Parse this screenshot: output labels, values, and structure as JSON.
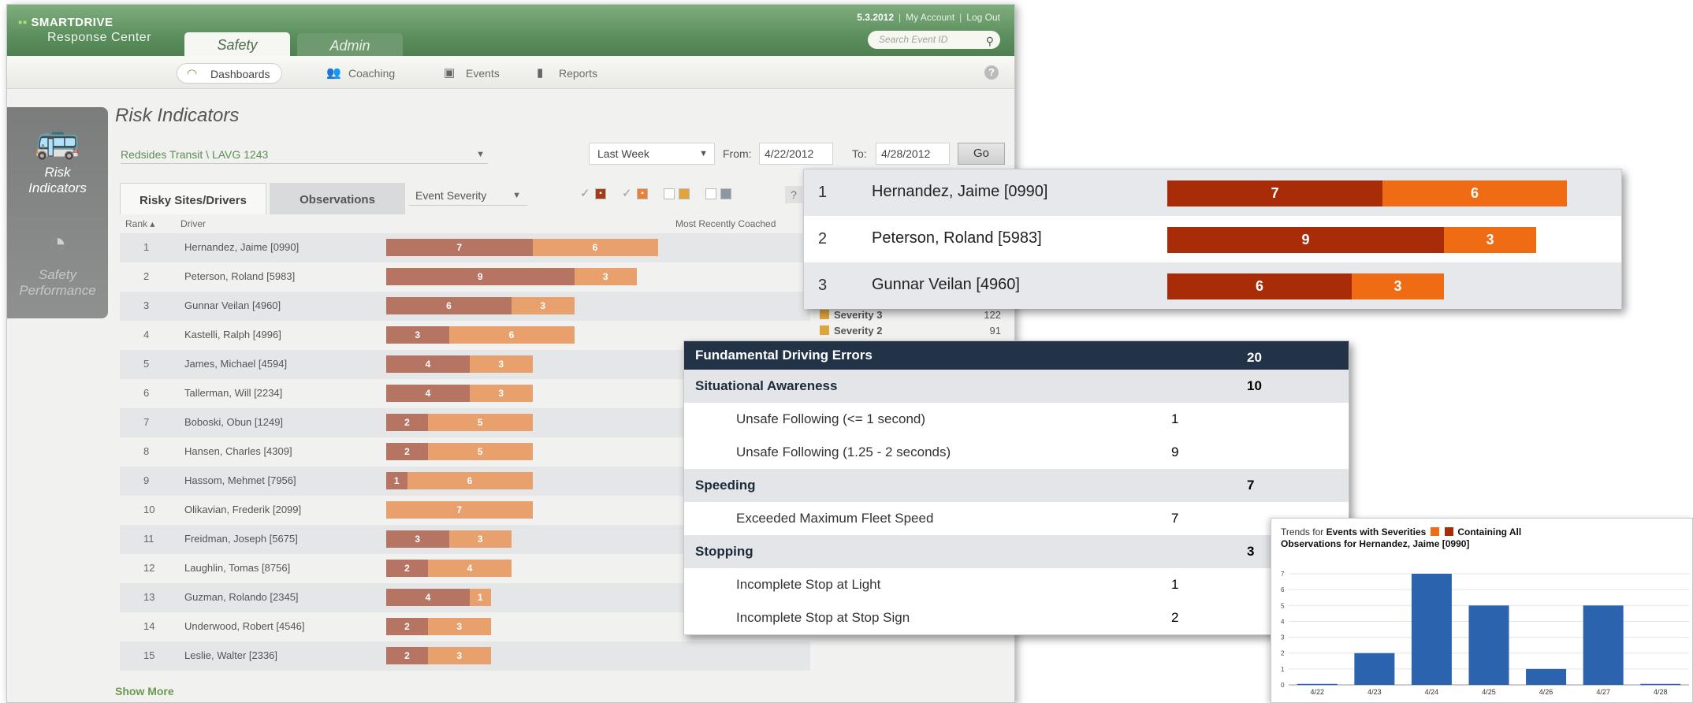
{
  "app": {
    "logo_line1": "SMARTDRIVE",
    "logo_line2": "Response Center",
    "tabs": [
      "Safety",
      "Admin"
    ],
    "date": "5.3.2012",
    "my_account": "My Account",
    "logout": "Log Out",
    "search_placeholder": "Search Event ID"
  },
  "nav": {
    "dashboards": "Dashboards",
    "coaching": "Coaching",
    "events": "Events",
    "reports": "Reports"
  },
  "sidebar": {
    "risk": [
      "Risk",
      "Indicators"
    ],
    "perf": [
      "Safety",
      "Performance"
    ]
  },
  "page": {
    "title": "Risk Indicators",
    "site": "Redsides Transit \\ LAVG 1243",
    "period": "Last Week",
    "from_label": "From:",
    "from_value": "4/22/2012",
    "to_label": "To:",
    "to_value": "4/28/2012",
    "go": "Go",
    "tab_risky": "Risky Sites/Drivers",
    "tab_obs": "Observations",
    "sev_select": "Event Severity",
    "help": "?",
    "col_rank": "Rank",
    "col_driver": "Driver",
    "col_coached": "Most Recently Coached",
    "show_more": "Show More"
  },
  "colors": {
    "main_dark": "#b67563",
    "main_light": "#e8a16c",
    "zoom_dark": "#a72c07",
    "zoom_light": "#ef6c14",
    "chart_bar": "#2c63ae"
  },
  "drivers": [
    {
      "rank": "1",
      "name": "Hernandez, Jaime [0990]",
      "dark": 7,
      "light": 6
    },
    {
      "rank": "2",
      "name": "Peterson, Roland [5983]",
      "dark": 9,
      "light": 3
    },
    {
      "rank": "3",
      "name": "Gunnar Veilan [4960]",
      "dark": 6,
      "light": 3
    },
    {
      "rank": "4",
      "name": "Kastelli, Ralph [4996]",
      "dark": 3,
      "light": 6
    },
    {
      "rank": "5",
      "name": "James, Michael [4594]",
      "dark": 4,
      "light": 3
    },
    {
      "rank": "6",
      "name": "Tallerman, Will [2234]",
      "dark": 4,
      "light": 3
    },
    {
      "rank": "7",
      "name": "Boboski, Obun [1249]",
      "dark": 2,
      "light": 5
    },
    {
      "rank": "8",
      "name": "Hansen, Charles [4309]",
      "dark": 2,
      "light": 5
    },
    {
      "rank": "9",
      "name": "Hassom, Mehmet [7956]",
      "dark": 1,
      "light": 6
    },
    {
      "rank": "10",
      "name": "Olikavian, Frederik [2099]",
      "dark": 0,
      "light": 7
    },
    {
      "rank": "11",
      "name": "Freidman, Joseph [5675]",
      "dark": 3,
      "light": 3
    },
    {
      "rank": "12",
      "name": "Laughlin, Tomas [8756]",
      "dark": 2,
      "light": 4
    },
    {
      "rank": "13",
      "name": "Guzman, Rolando [2345]",
      "dark": 4,
      "light": 1
    },
    {
      "rank": "14",
      "name": "Underwood, Robert [4546]",
      "dark": 2,
      "light": 3
    },
    {
      "rank": "15",
      "name": "Leslie, Walter [2336]",
      "dark": 2,
      "light": 3
    }
  ],
  "legend_peek": [
    {
      "label": "Severity 3",
      "value": "122"
    },
    {
      "label": "Severity 2",
      "value": "91"
    }
  ],
  "observations": [
    {
      "kind": "head",
      "label": "Fundamental Driving Errors",
      "count": "20"
    },
    {
      "kind": "cat",
      "label": "Situational Awareness",
      "count": "10"
    },
    {
      "kind": "sub",
      "label": "Unsafe Following (<= 1 second)",
      "count": "1"
    },
    {
      "kind": "sub",
      "label": "Unsafe Following (1.25 - 2 seconds)",
      "count": "9"
    },
    {
      "kind": "cat",
      "label": "Speeding",
      "count": "7"
    },
    {
      "kind": "sub",
      "label": "Exceeded Maximum Fleet Speed",
      "count": "7"
    },
    {
      "kind": "cat",
      "label": "Stopping",
      "count": "3"
    },
    {
      "kind": "sub",
      "label": "Incomplete Stop at Light",
      "count": "1"
    },
    {
      "kind": "sub",
      "label": "Incomplete Stop at Stop Sign",
      "count": "2"
    }
  ],
  "trend": {
    "prefix": "Trends for ",
    "events_label": "Events with Severities",
    "containing": "Containing All",
    "line2": "Observations for Hernandez, Jaime [0990]"
  },
  "chart_data": {
    "type": "bar",
    "categories": [
      "4/22",
      "4/23",
      "4/24",
      "4/25",
      "4/26",
      "4/27",
      "4/28"
    ],
    "values": [
      0,
      2,
      7,
      5,
      1,
      5,
      0
    ],
    "ylim": [
      0,
      7
    ],
    "yticks": [
      "0",
      "1",
      "2",
      "3",
      "4",
      "5",
      "6",
      "7"
    ],
    "grid": true
  }
}
